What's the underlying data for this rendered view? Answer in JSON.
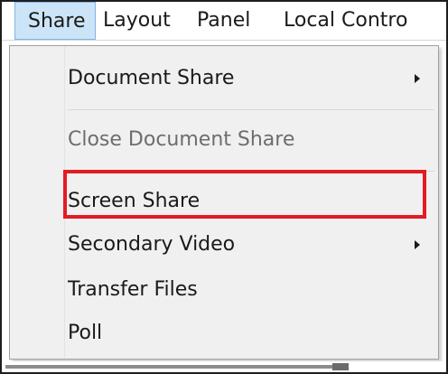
{
  "menubar": {
    "items": [
      "Share",
      "Layout",
      "Panel",
      "Local Contro"
    ],
    "active_index": 0
  },
  "share_menu": {
    "items": [
      {
        "label": "Document Share",
        "submenu": true,
        "enabled": true
      },
      {
        "label": "Close Document Share",
        "submenu": false,
        "enabled": false
      },
      {
        "label": "Screen Share",
        "submenu": false,
        "enabled": true,
        "highlighted": true
      },
      {
        "label": "Secondary Video",
        "submenu": true,
        "enabled": true
      },
      {
        "label": "Transfer Files",
        "submenu": false,
        "enabled": true
      },
      {
        "label": "Poll",
        "submenu": false,
        "enabled": true
      }
    ]
  },
  "colors": {
    "highlight_outline": "#e31b23",
    "active_menu_bg": "#cce4f7",
    "menu_bg": "#f0f0f0",
    "disabled_text": "#6d6d6d"
  }
}
